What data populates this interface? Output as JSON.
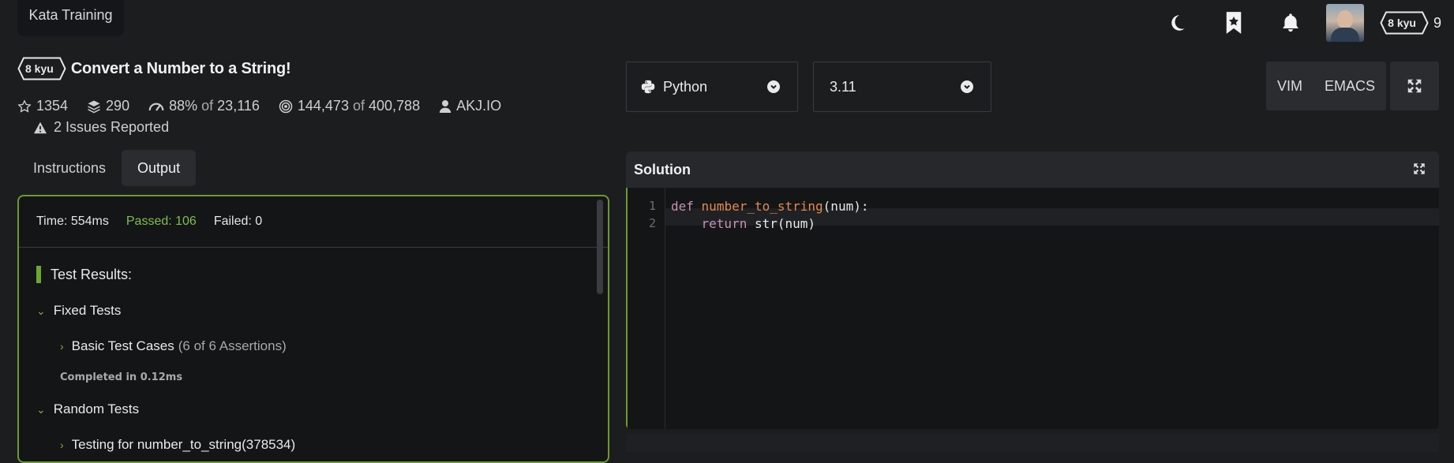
{
  "tooltip": {
    "text": "Kata Training"
  },
  "topbar": {
    "rank_badge": "8 kyu",
    "honor": "9",
    "icons": [
      "moon-icon",
      "bookmark-star-icon",
      "bell-icon"
    ]
  },
  "kata": {
    "rank": "8 kyu",
    "title": "Convert a Number to a String!",
    "stats": {
      "stars": "1354",
      "collections": "290",
      "satisfaction": "88%",
      "satisfaction_of": "of",
      "satisfaction_votes": "23,116",
      "completed": "144,473",
      "completed_of": "of",
      "attempted": "400,788",
      "author": "AKJ.IO"
    },
    "issues": "2 Issues Reported"
  },
  "tabs": [
    {
      "label": "Instructions",
      "active": false
    },
    {
      "label": "Output",
      "active": true
    }
  ],
  "output": {
    "time": "Time: 554ms",
    "passed": "Passed: 106",
    "failed": "Failed: 0",
    "test_results_title": "Test Results:",
    "fixed_tests": "Fixed Tests",
    "basic_case": "Basic Test Cases",
    "basic_assertions": "(6 of 6 Assertions)",
    "completed": "Completed in 0.12ms",
    "random_tests": "Random Tests",
    "random_case": "Testing for number_to_string(378534)"
  },
  "language_select": {
    "value": "Python"
  },
  "version_select": {
    "value": "3.11"
  },
  "modes": [
    "VIM",
    "EMACS"
  ],
  "editor": {
    "title": "Solution",
    "line_numbers": [
      "1",
      "2"
    ],
    "line1": {
      "kw": "def",
      "fn": "number_to_string",
      "rest": "(num):"
    },
    "line2": {
      "indent": "    ",
      "kw": "return",
      "rest": " str(num)"
    }
  },
  "colors": {
    "accent_green": "#6a9a32",
    "passed_green": "#7fbf4a",
    "keyword": "#c792b0",
    "function": "#e48a4a"
  }
}
